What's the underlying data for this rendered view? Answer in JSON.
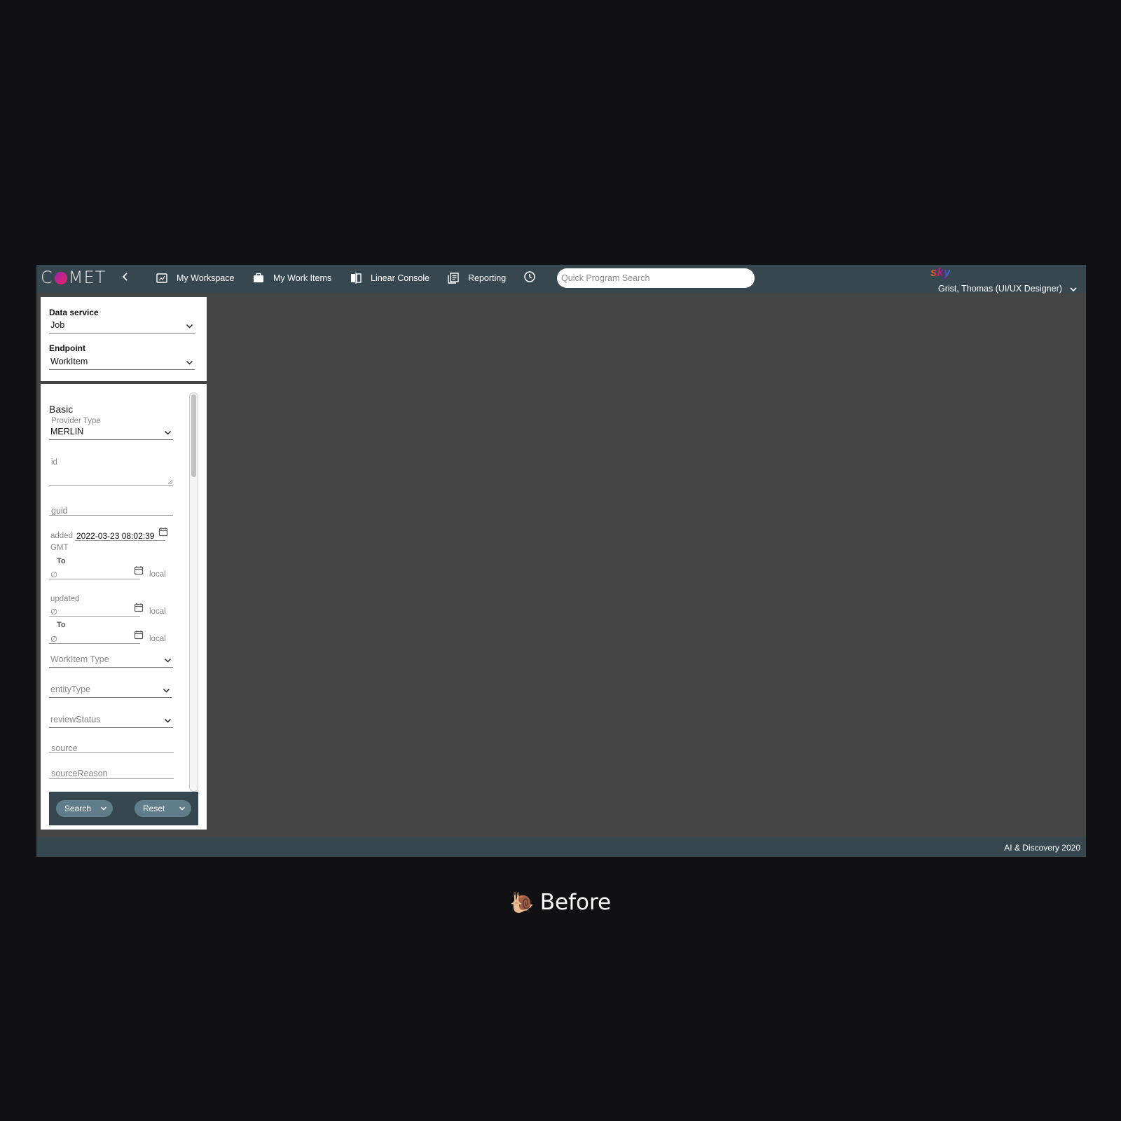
{
  "app": {
    "logo": "COMET",
    "nav": [
      {
        "label": "My Workspace",
        "icon": "workspace-icon"
      },
      {
        "label": "My Work Items",
        "icon": "briefcase-icon"
      },
      {
        "label": "Linear Console",
        "icon": "console-icon"
      },
      {
        "label": "Reporting",
        "icon": "reporting-icon"
      }
    ],
    "history_icon": "history-icon",
    "search_placeholder": "Quick Program Search",
    "brand": "sky",
    "user": "Grist, Thomas (UI/UX Designer)"
  },
  "query": {
    "data_service_label": "Data service",
    "data_service_value": "Job",
    "endpoint_label": "Endpoint",
    "endpoint_value": "WorkItem"
  },
  "filters": {
    "section": "Basic",
    "provider_type_label": "Provider Type",
    "provider_type_value": "MERLIN",
    "id_placeholder": "id",
    "guid_placeholder": "guid",
    "added_label": "added",
    "added_value": "2022-03-23 08:02:39",
    "added_tz": "GMT",
    "to_label": "To",
    "empty_date": "∅",
    "local_label": "local",
    "updated_label": "updated",
    "workitem_type_placeholder": "WorkItem Type",
    "entity_type_placeholder": "entityType",
    "review_status_placeholder": "reviewStatus",
    "source_placeholder": "source",
    "source_reason_placeholder": "sourceReason"
  },
  "actions": {
    "search": "Search",
    "reset": "Reset"
  },
  "footer": "AI & Discovery 2020",
  "caption": {
    "emoji": "🐌",
    "text": "Before"
  },
  "colors": {
    "topbar": "#37474f",
    "workspace": "#444444",
    "button": "#607d8b",
    "backdrop": "#111012"
  }
}
